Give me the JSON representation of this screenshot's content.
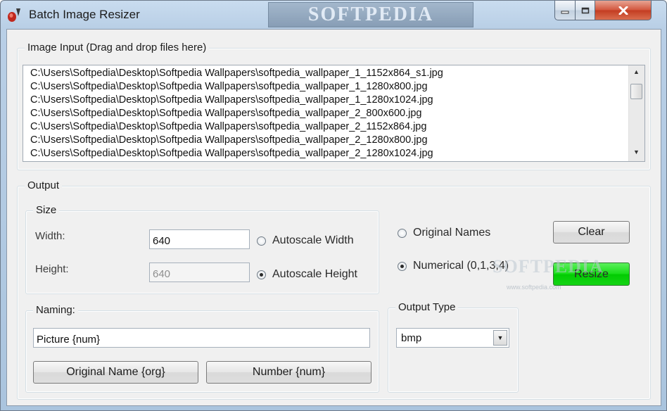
{
  "window": {
    "title": "Batch Image Resizer",
    "title_watermark": "SOFTPEDIA"
  },
  "image_input": {
    "group_label": "Image Input (Drag and drop files here)",
    "files": [
      "C:\\Users\\Softpedia\\Desktop\\Softpedia Wallpapers\\softpedia_wallpaper_1_1152x864_s1.jpg",
      "C:\\Users\\Softpedia\\Desktop\\Softpedia Wallpapers\\softpedia_wallpaper_1_1280x800.jpg",
      "C:\\Users\\Softpedia\\Desktop\\Softpedia Wallpapers\\softpedia_wallpaper_1_1280x1024.jpg",
      "C:\\Users\\Softpedia\\Desktop\\Softpedia Wallpapers\\softpedia_wallpaper_2_800x600.jpg",
      "C:\\Users\\Softpedia\\Desktop\\Softpedia Wallpapers\\softpedia_wallpaper_2_1152x864.jpg",
      "C:\\Users\\Softpedia\\Desktop\\Softpedia Wallpapers\\softpedia_wallpaper_2_1280x800.jpg",
      "C:\\Users\\Softpedia\\Desktop\\Softpedia Wallpapers\\softpedia_wallpaper_2_1280x1024.jpg"
    ]
  },
  "output": {
    "group_label": "Output",
    "size": {
      "group_label": "Size",
      "width_label": "Width:",
      "width_value": "640",
      "height_label": "Height:",
      "height_value": "640",
      "autoscale_width_label": "Autoscale Width",
      "autoscale_height_label": "Autoscale Height",
      "selected": "autoscale_height"
    },
    "naming_mode": {
      "original_names_label": "Original Names",
      "numerical_label": "Numerical (0,1,3,4)",
      "selected": "numerical"
    },
    "clear_label": "Clear",
    "resize_label": "Resize",
    "resize_color": "#0bd60b",
    "naming": {
      "group_label": "Naming:",
      "value": "Picture {num}",
      "original_name_button": "Original Name {org}",
      "number_button": "Number {num}"
    },
    "output_type": {
      "group_label": "Output Type",
      "selected": "bmp"
    }
  },
  "watermark": {
    "text": "SOFTPEDIA",
    "url": "www.softpedia.com"
  },
  "icons": [
    "app-icon",
    "minimize-icon",
    "maximize-icon",
    "close-icon",
    "scroll-up-icon",
    "scroll-down-icon",
    "dropdown-arrow-icon"
  ]
}
